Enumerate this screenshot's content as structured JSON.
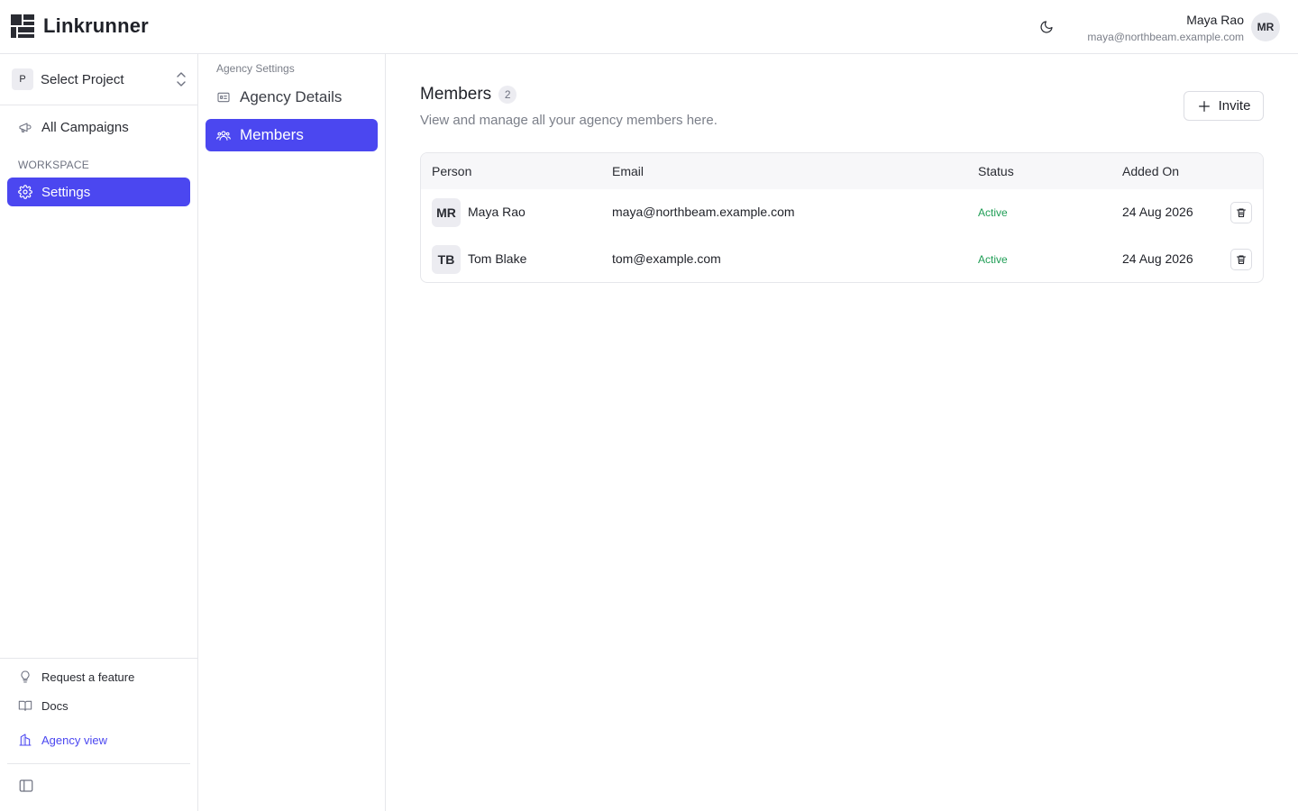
{
  "app": {
    "name": "Linkrunner"
  },
  "header": {
    "theme_icon": "moon-icon",
    "user": {
      "name": "Maya Rao",
      "email": "maya@northbeam.example.com",
      "initials": "MR"
    }
  },
  "sidebar": {
    "project": {
      "badge": "P",
      "label": "Select Project"
    },
    "items": [
      {
        "label": "All Campaigns",
        "icon": "megaphone-icon"
      }
    ],
    "section_label": "WORKSPACE",
    "workspace_items": [
      {
        "label": "Settings",
        "icon": "gear-icon",
        "active": true
      }
    ],
    "bottom": [
      {
        "label": "Request a feature",
        "icon": "lightbulb-icon"
      },
      {
        "label": "Docs",
        "icon": "book-icon"
      },
      {
        "label": "Agency view",
        "icon": "building-icon"
      }
    ]
  },
  "subnav": {
    "title": "Agency Settings",
    "items": [
      {
        "label": "Agency Details",
        "icon": "id-card-icon",
        "active": false
      },
      {
        "label": "Members",
        "icon": "users-icon",
        "active": true
      }
    ]
  },
  "main": {
    "title": "Members",
    "count": "2",
    "subtitle": "View and manage all your agency members here.",
    "invite_label": "Invite",
    "table": {
      "columns": [
        "Person",
        "Email",
        "Status",
        "Added On"
      ],
      "rows": [
        {
          "initials": "MR",
          "name": "Maya Rao",
          "email": "maya@northbeam.example.com",
          "status": "Active",
          "added_on": "24 Aug 2026"
        },
        {
          "initials": "TB",
          "name": "Tom Blake",
          "email": "tom@example.com",
          "status": "Active",
          "added_on": "24 Aug 2026"
        }
      ]
    }
  },
  "colors": {
    "accent": "#4b47f0",
    "status_active": "#1f9d55",
    "border": "#e6e7eb"
  }
}
